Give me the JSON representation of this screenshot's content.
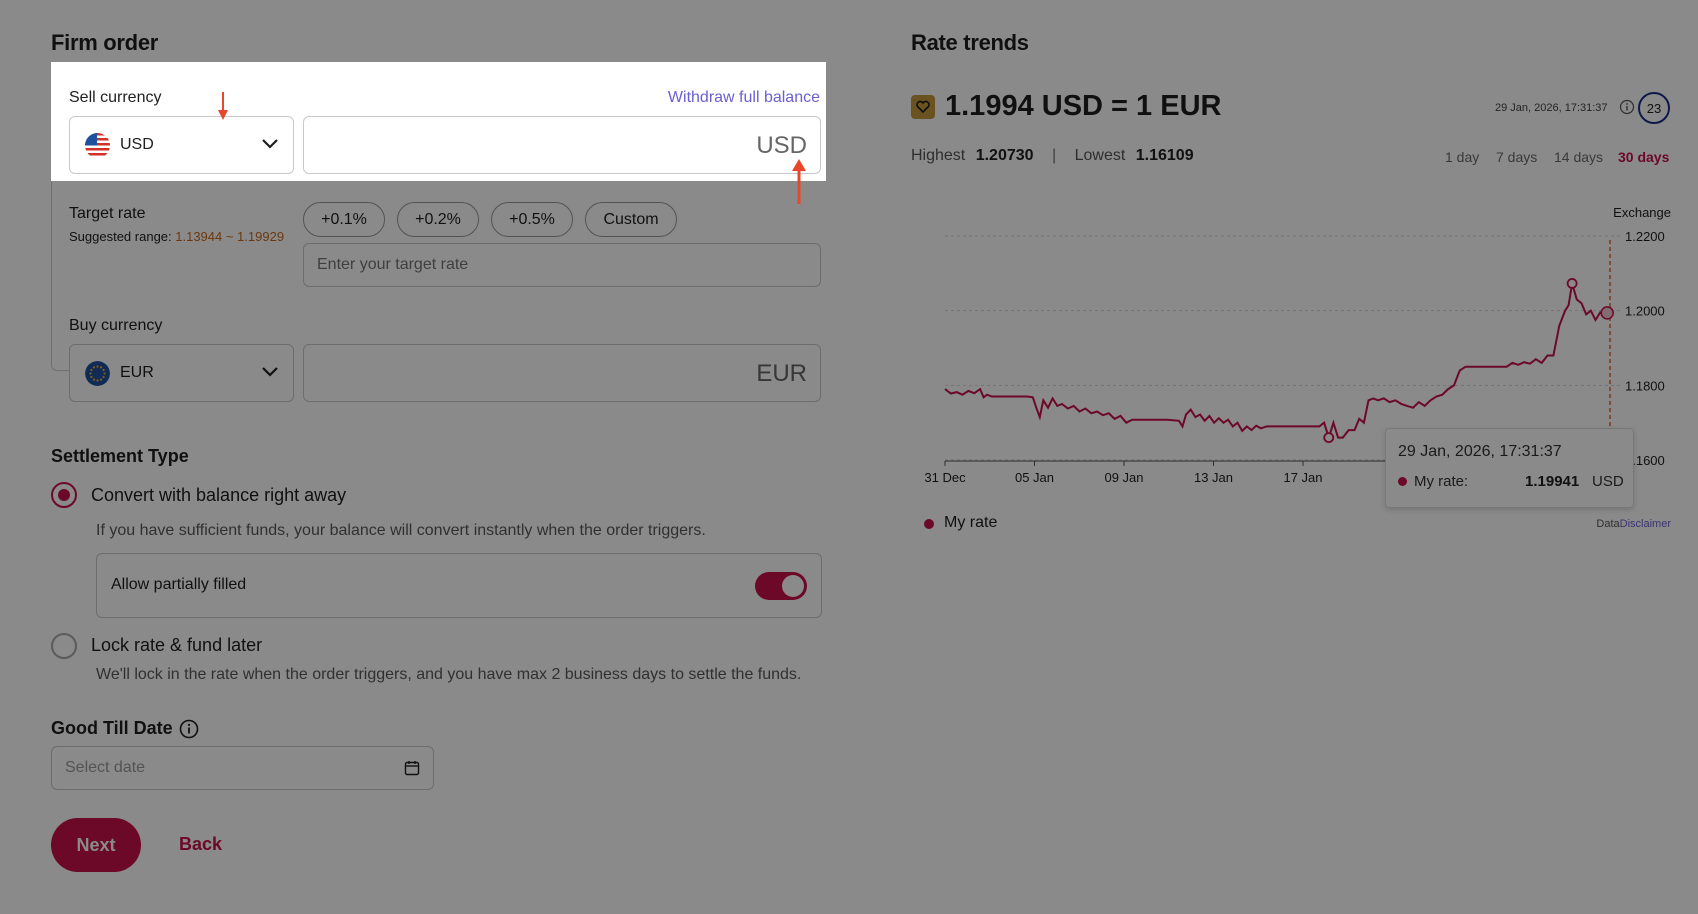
{
  "form": {
    "title": "Firm order",
    "sell_label": "Sell currency",
    "withdraw_label": "Withdraw full balance",
    "sell_currency": "USD",
    "sell_amount_suffix": "USD",
    "target_label": "Target rate",
    "suggested_prefix": "Suggested range: ",
    "suggested_range": "1.13944 ~ 1.19929",
    "rate_chips": [
      "+0.1%",
      "+0.2%",
      "+0.5%",
      "Custom"
    ],
    "target_placeholder": "Enter your target rate",
    "buy_label": "Buy currency",
    "buy_currency": "EUR",
    "buy_amount_suffix": "EUR",
    "settlement_title": "Settlement Type",
    "option1_label": "Convert with balance right away",
    "option1_desc": "If you have sufficient funds, your balance will convert instantly when the order triggers.",
    "partial_label": "Allow partially filled",
    "option2_label": "Lock rate & fund later",
    "option2_desc": "We'll lock in the rate when the order triggers, and you have max 2 business days to settle the funds.",
    "gtd_title": "Good Till Date",
    "gtd_placeholder": "Select date",
    "next_label": "Next",
    "back_label": "Back"
  },
  "trends": {
    "title": "Rate trends",
    "rate_text": "1.1994 USD = 1 EUR",
    "timestamp": "29 Jan, 2026, 17:31:37",
    "refresh_count": "23",
    "highest_label": "Highest",
    "highest_value": "1.20730",
    "sep": "|",
    "lowest_label": "Lowest",
    "lowest_value": "1.16109",
    "periods": [
      "1 day",
      "7 days",
      "14 days",
      "30 days"
    ],
    "active_period": "30 days",
    "legend_label": "My rate",
    "data_label": "Data",
    "disclaimer_label": "Disclaimer"
  },
  "tooltip": {
    "date": "29 Jan, 2026, 17:31:37",
    "label": "My rate:",
    "value": "1.19941",
    "unit": "USD"
  },
  "colors": {
    "accent": "#c8104a",
    "link": "#6a5fd0",
    "orange": "#c76a1a"
  },
  "chart_data": {
    "type": "line",
    "ylabel": "Exchange",
    "y_ticks": [
      "1.2200",
      "1.2000",
      "1.1800",
      "1.1600"
    ],
    "ylim": [
      1.16,
      1.22
    ],
    "x_ticks": [
      "31 Dec",
      "05 Jan",
      "09 Jan",
      "13 Jan",
      "17 Jan"
    ],
    "series": [
      {
        "name": "My rate",
        "points": [
          [
            0,
            1.179
          ],
          [
            0.5,
            1.1778
          ],
          [
            1,
            1.1782
          ],
          [
            1.5,
            1.1775
          ],
          [
            2,
            1.1785
          ],
          [
            2.5,
            1.1779
          ],
          [
            3,
            1.179
          ],
          [
            3.3,
            1.1768
          ],
          [
            3.6,
            1.1775
          ],
          [
            4,
            1.177
          ],
          [
            5,
            1.177
          ],
          [
            6,
            1.177
          ],
          [
            7,
            1.177
          ],
          [
            7.5,
            1.1768
          ],
          [
            7.8,
            1.174
          ],
          [
            8.1,
            1.1715
          ],
          [
            8.4,
            1.176
          ],
          [
            8.8,
            1.174
          ],
          [
            9.2,
            1.1765
          ],
          [
            9.6,
            1.1745
          ],
          [
            10,
            1.175
          ],
          [
            10.5,
            1.1738
          ],
          [
            11,
            1.1745
          ],
          [
            11.5,
            1.173
          ],
          [
            12,
            1.1738
          ],
          [
            12.5,
            1.1725
          ],
          [
            13,
            1.173
          ],
          [
            13.5,
            1.172
          ],
          [
            14,
            1.1725
          ],
          [
            14.5,
            1.171
          ],
          [
            15,
            1.1718
          ],
          [
            15.5,
            1.17
          ],
          [
            16,
            1.1708
          ],
          [
            17,
            1.1708
          ],
          [
            18,
            1.1708
          ],
          [
            19,
            1.1708
          ],
          [
            20,
            1.1705
          ],
          [
            20.3,
            1.169
          ],
          [
            20.6,
            1.1722
          ],
          [
            21,
            1.1735
          ],
          [
            21.4,
            1.1715
          ],
          [
            21.8,
            1.1722
          ],
          [
            22.2,
            1.1705
          ],
          [
            22.6,
            1.1718
          ],
          [
            23,
            1.17
          ],
          [
            23.4,
            1.1712
          ],
          [
            23.8,
            1.17
          ],
          [
            24.2,
            1.1708
          ],
          [
            24.6,
            1.169
          ],
          [
            25,
            1.17
          ],
          [
            25.4,
            1.1678
          ],
          [
            25.8,
            1.169
          ],
          [
            26.2,
            1.168
          ],
          [
            26.6,
            1.1692
          ],
          [
            27,
            1.1685
          ],
          [
            27.5,
            1.169
          ],
          [
            28,
            1.169
          ],
          [
            28.5,
            1.169
          ],
          [
            29,
            1.169
          ],
          [
            29.5,
            1.169
          ],
          [
            30,
            1.169
          ],
          [
            30.5,
            1.169
          ],
          [
            31,
            1.169
          ],
          [
            32,
            1.169
          ],
          [
            32.4,
            1.17
          ],
          [
            32.8,
            1.166
          ],
          [
            33.2,
            1.17
          ],
          [
            33.6,
            1.166
          ],
          [
            34,
            1.166
          ],
          [
            34.5,
            1.168
          ],
          [
            35,
            1.168
          ],
          [
            35.4,
            1.171
          ],
          [
            35.8,
            1.17
          ],
          [
            36.2,
            1.176
          ],
          [
            36.6,
            1.1765
          ],
          [
            37,
            1.176
          ],
          [
            37.5,
            1.1765
          ],
          [
            38,
            1.1755
          ],
          [
            38.5,
            1.176
          ],
          [
            39,
            1.175
          ],
          [
            39.5,
            1.1745
          ],
          [
            40,
            1.174
          ],
          [
            40.5,
            1.1755
          ],
          [
            41,
            1.1745
          ],
          [
            41.5,
            1.176
          ],
          [
            42,
            1.177
          ],
          [
            42.5,
            1.1775
          ],
          [
            43,
            1.179
          ],
          [
            43.5,
            1.18
          ],
          [
            44,
            1.184
          ],
          [
            44.5,
            1.185
          ],
          [
            45,
            1.185
          ],
          [
            46,
            1.185
          ],
          [
            47,
            1.185
          ],
          [
            48,
            1.185
          ],
          [
            48.5,
            1.186
          ],
          [
            49,
            1.1855
          ],
          [
            49.5,
            1.1862
          ],
          [
            50,
            1.1858
          ],
          [
            50.5,
            1.187
          ],
          [
            51,
            1.186
          ],
          [
            51.5,
            1.188
          ],
          [
            52,
            1.188
          ],
          [
            52.5,
            1.196
          ],
          [
            53,
            1.2
          ],
          [
            53.3,
            1.2015
          ],
          [
            53.6,
            1.2073
          ],
          [
            54,
            1.203
          ],
          [
            54.4,
            1.202
          ],
          [
            54.8,
            1.199
          ],
          [
            55.2,
            1.2
          ],
          [
            55.6,
            1.1975
          ],
          [
            56,
            1.1995
          ],
          [
            56.3,
            1.199
          ],
          [
            56.6,
            1.1994
          ]
        ]
      }
    ]
  }
}
